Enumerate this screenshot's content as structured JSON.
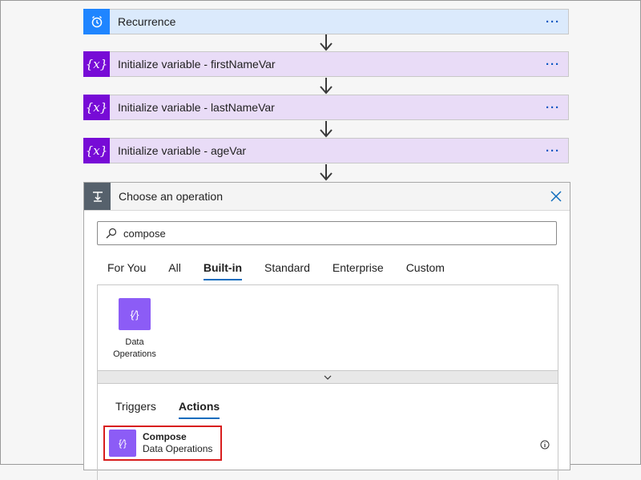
{
  "steps": [
    {
      "title": "Recurrence",
      "icon": "alarm-clock-icon"
    },
    {
      "title": "Initialize variable - firstNameVar",
      "icon": "variable-icon"
    },
    {
      "title": "Initialize variable - lastNameVar",
      "icon": "variable-icon"
    },
    {
      "title": "Initialize variable - ageVar",
      "icon": "variable-icon"
    }
  ],
  "more_label": "···",
  "variable_glyph": "{x}",
  "panel": {
    "title": "Choose an operation",
    "search_value": "compose",
    "tabs": [
      "For You",
      "All",
      "Built-in",
      "Standard",
      "Enterprise",
      "Custom"
    ],
    "active_tab": "Built-in",
    "connectors": [
      {
        "label_line1": "Data",
        "label_line2": "Operations",
        "glyph": "{⁄}"
      }
    ],
    "subtabs": [
      "Triggers",
      "Actions"
    ],
    "active_subtab": "Actions",
    "actions": [
      {
        "name": "Compose",
        "connector": "Data Operations",
        "glyph": "{⁄}"
      }
    ]
  },
  "colors": {
    "recurrence_accent": "#1f85ff",
    "variable_accent": "#770bd6",
    "data_operations": "#8c5cf6",
    "highlight_border": "#d81e1e"
  }
}
